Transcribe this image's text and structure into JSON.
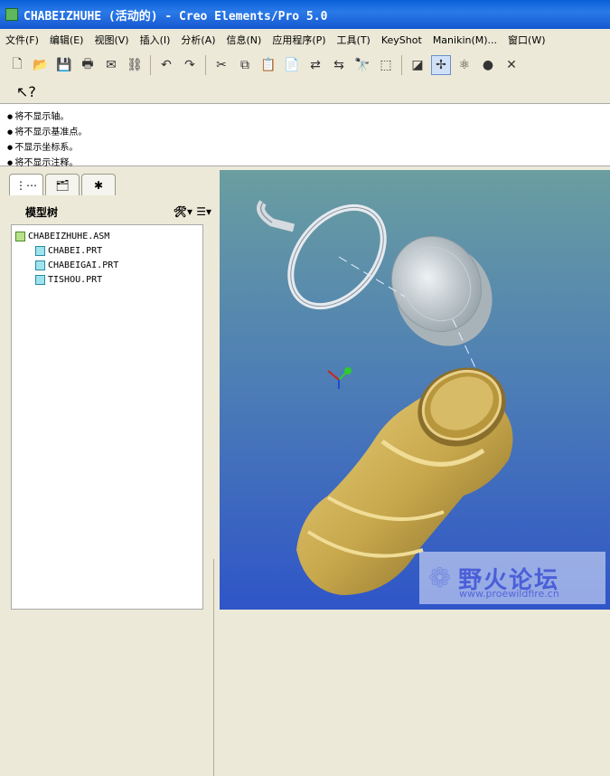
{
  "title": "CHABEIZHUHE (活动的) - Creo Elements/Pro 5.0",
  "menu": [
    "文件(F)",
    "编辑(E)",
    "视图(V)",
    "插入(I)",
    "分析(A)",
    "信息(N)",
    "应用程序(P)",
    "工具(T)",
    "KeyShot",
    "Manikin(M)...",
    "窗口(W)"
  ],
  "messages": [
    "将不显示轴。",
    "将不显示基准点。",
    "不显示坐标系。",
    "将不显示注释。"
  ],
  "tree": {
    "title": "模型树",
    "items": [
      "CHABEIZHUHE.ASM",
      "CHABEI.PRT",
      "CHABEIGAI.PRT",
      "TISHOU.PRT"
    ]
  },
  "watermark": {
    "text": "野火论坛",
    "url": "www.proewildfire.cn"
  }
}
